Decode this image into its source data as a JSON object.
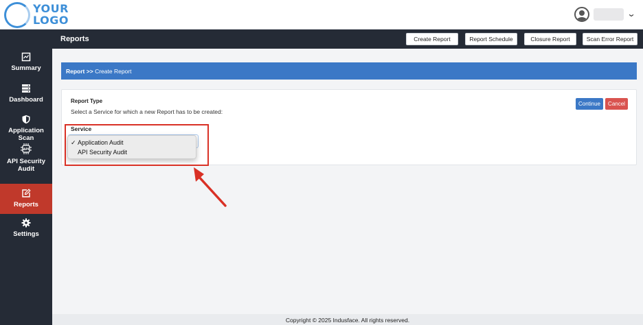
{
  "logo": {
    "line1": "YOUR",
    "line2": "LOGO"
  },
  "user": {
    "name": "",
    "avatar_icon": "user-circle-icon",
    "menu_icon": "chevron-down-icon"
  },
  "sidebar": {
    "items": [
      {
        "label": "Summary",
        "icon": "summary-chart-icon"
      },
      {
        "label": "Dashboard",
        "icon": "dashboard-server-icon"
      },
      {
        "label": "Application Scan",
        "icon": "shield-icon"
      },
      {
        "label": "API Security Audit",
        "icon": "api-chip-icon"
      },
      {
        "label": "Reports",
        "icon": "edit-icon",
        "active": true
      },
      {
        "label": "Settings",
        "icon": "gear-icon"
      }
    ]
  },
  "header": {
    "title": "Reports",
    "buttons": [
      "Create Report",
      "Report Schedule",
      "Closure Report",
      "Scan Error Report"
    ]
  },
  "breadcrumb": {
    "root": "Report",
    "separator": ">>",
    "current": "Create Report"
  },
  "form": {
    "report_type_label": "Report Type",
    "instruction": "Select a Service for which a new Report has to be created:",
    "service_label": "Service",
    "options": [
      "Application Audit",
      "API Security Audit"
    ],
    "selected_index": 0,
    "continue_label": "Continue",
    "cancel_label": "Cancel"
  },
  "footer": {
    "copyright": "Copyright © 2025 Indusface. All rights reserved."
  },
  "colors": {
    "sidebar_bg": "#252b36",
    "active_item": "#c0392b",
    "accent_blue": "#3b78c6",
    "cancel_red": "#d9534f",
    "highlight_red": "#d93025"
  }
}
